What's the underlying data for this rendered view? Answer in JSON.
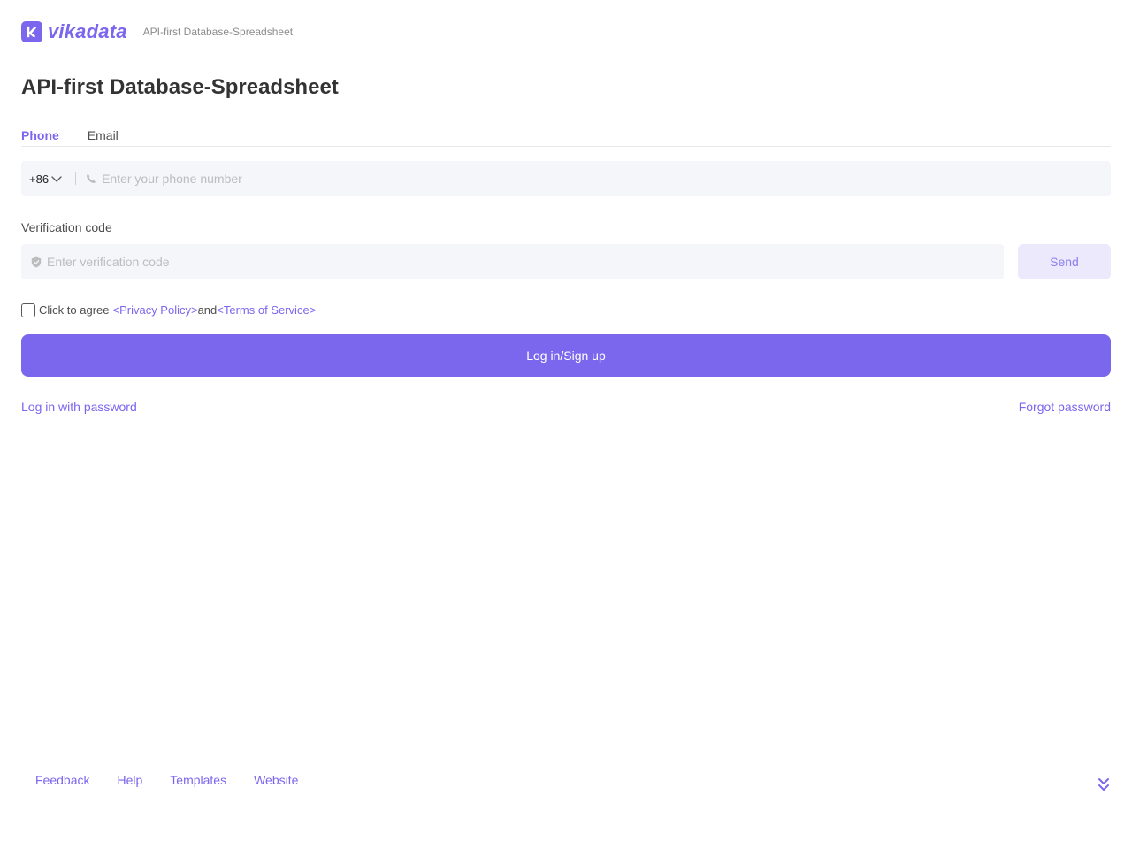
{
  "brand": {
    "name": "vikadata",
    "tagline": "API-first Database-Spreadsheet",
    "accent_color": "#7b67ee"
  },
  "page_title": "API-first Database-Spreadsheet",
  "tabs": [
    {
      "label": "Phone",
      "active": true
    },
    {
      "label": "Email",
      "active": false
    }
  ],
  "phone": {
    "area_code": "+86",
    "placeholder": "Enter your phone number",
    "icon": "phone-icon"
  },
  "verification": {
    "label": "Verification code",
    "placeholder": "Enter verification code",
    "icon": "shield-icon",
    "send_label": "Send"
  },
  "agreement": {
    "prefix": "Click to agree",
    "privacy_link": "<Privacy Policy>",
    "conjunction": "and",
    "terms_link": "<Terms of Service>",
    "checked": false
  },
  "submit_label": "Log in/Sign up",
  "links": {
    "password_login": "Log in with password",
    "forgot_password": "Forgot password"
  },
  "footer": {
    "links": [
      "Feedback",
      "Help",
      "Templates",
      "Website"
    ],
    "expand_icon": "double-chevron-down-icon"
  }
}
